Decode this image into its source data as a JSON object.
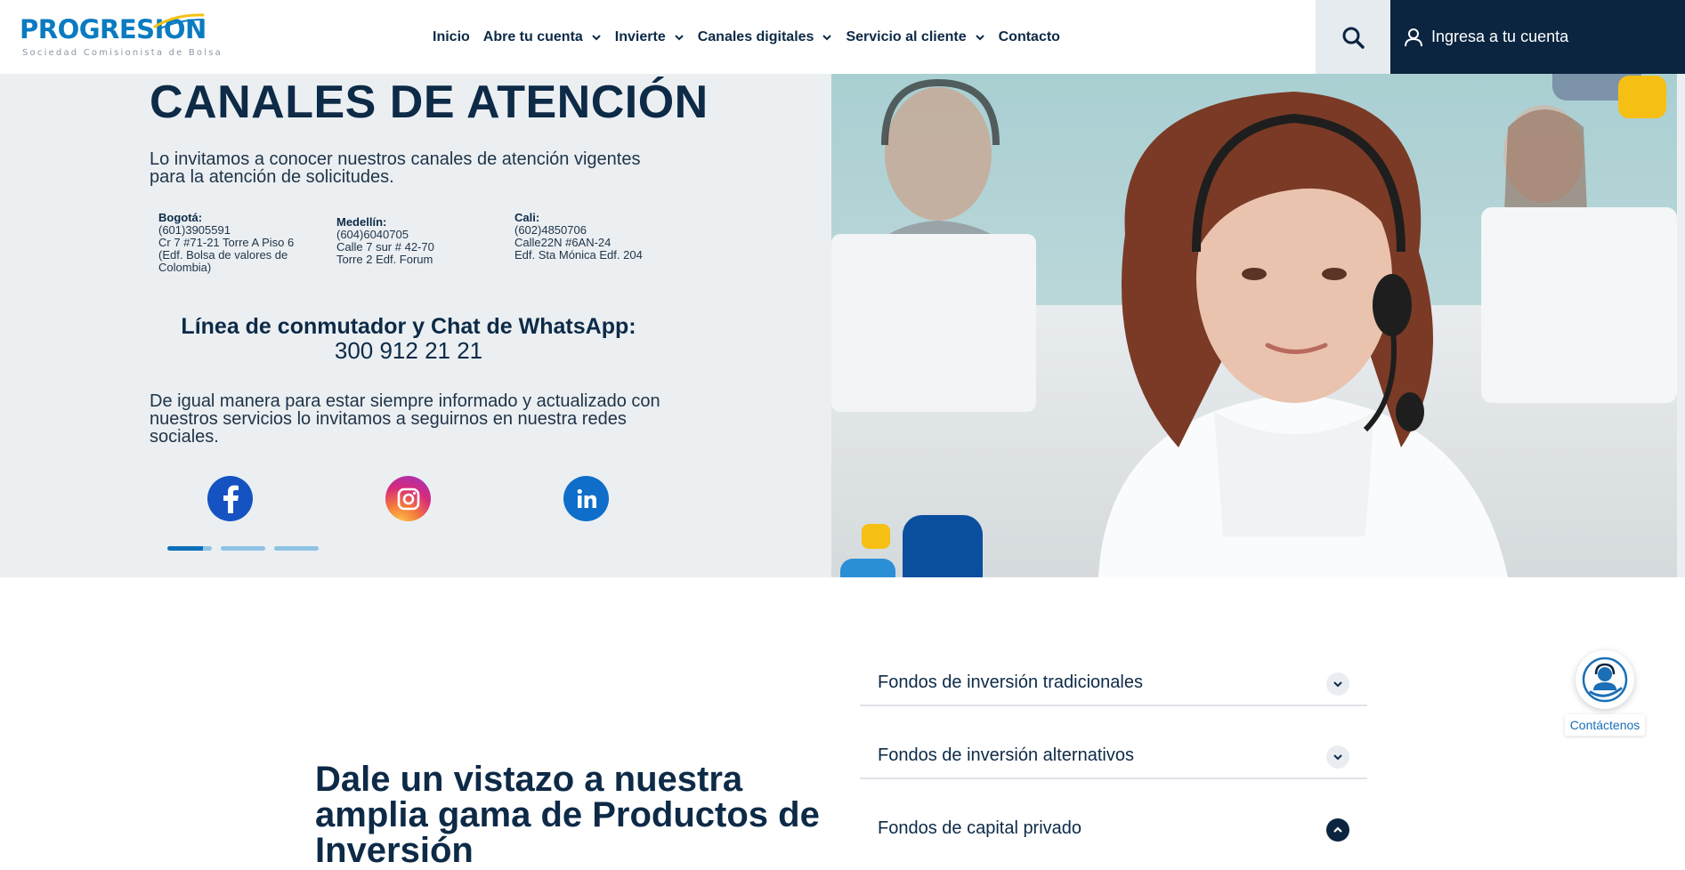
{
  "header": {
    "logo": {
      "name": "PROGRESION",
      "tagline": "Sociedad Comisionista de Bolsa"
    },
    "nav": [
      {
        "label": "Inicio",
        "dropdown": false
      },
      {
        "label": "Abre tu cuenta",
        "dropdown": true
      },
      {
        "label": "Invierte",
        "dropdown": true
      },
      {
        "label": "Canales digitales",
        "dropdown": true
      },
      {
        "label": "Servicio al cliente",
        "dropdown": true
      },
      {
        "label": "Contacto",
        "dropdown": false
      }
    ],
    "search_icon": "search-icon",
    "login_label": "Ingresa a tu cuenta"
  },
  "hero": {
    "title": "CANALES DE ATENCIÓN",
    "intro": "Lo invitamos a conocer nuestros canales de atención vigentes para la atención de solicitudes.",
    "offices": [
      {
        "city": "Bogotá:",
        "lines": [
          "(601)3905591",
          "Cr 7 #71-21 Torre A Piso 6",
          "(Edf. Bolsa de valores de",
          "Colombia)"
        ]
      },
      {
        "city": "Medellín:",
        "lines": [
          "(604)6040705",
          "Calle 7 sur # 42-70",
          "Torre 2 Edf. Forum"
        ]
      },
      {
        "city": "Cali:",
        "lines": [
          "(602)4850706",
          "Calle22N #6AN-24",
          "Edf. Sta Mónica Edf. 204"
        ]
      }
    ],
    "line_title": "Línea de conmutador y Chat de WhatsApp:",
    "line_number": "300 912 21 21",
    "social_text": "De igual manera para estar siempre informado y actualizado con nuestros servicios lo invitamos a seguirnos en nuestra redes sociales.",
    "social_icons": [
      "facebook-icon",
      "instagram-icon",
      "linkedin-icon"
    ],
    "slider": {
      "slides": 3,
      "active": 1
    }
  },
  "products": {
    "title": "Dale un vistazo a nuestra amplia gama de Productos de Inversión",
    "accordion": [
      {
        "label": "Fondos de inversión tradicionales",
        "open": false
      },
      {
        "label": "Fondos de inversión alternativos",
        "open": false
      },
      {
        "label": "Fondos de capital privado",
        "open": true
      }
    ]
  },
  "contact_widget": {
    "label": "Contáctenos"
  },
  "colors": {
    "navy": "#0b2540",
    "brand_blue": "#0a7bc1",
    "hero_bg": "#ebeff2",
    "accent_yellow": "#f5c013"
  }
}
